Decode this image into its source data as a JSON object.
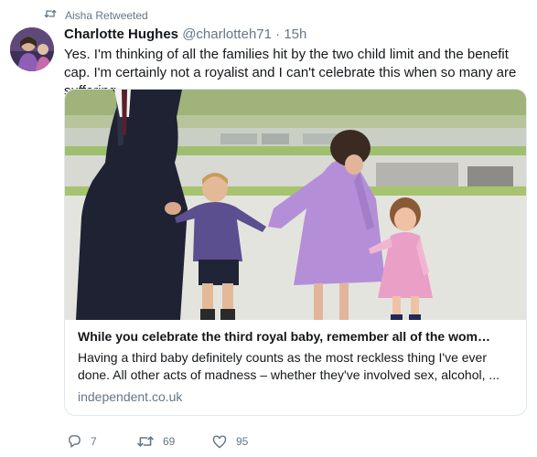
{
  "retweet_context": {
    "icon": "retweet-icon",
    "text": "Aisha Retweeted"
  },
  "tweet": {
    "name": "Charlotte Hughes",
    "handle": "@charlotteh71",
    "separator": "·",
    "time": "15h",
    "text": "Yes. I'm thinking of all the families hit by the two child limit and the benefit cap. I'm certainly not a royalist and I can't celebrate this when so many are suffering."
  },
  "card": {
    "title": "While you celebrate the third royal baby, remember all of the wom…",
    "description": "Having a third baby definitely counts as the most reckless thing I've ever done. All other acts of madness – whether they've involved sex, alcohol, ...",
    "domain": "independent.co.uk"
  },
  "actions": {
    "reply": {
      "icon": "reply-icon",
      "count": "7"
    },
    "retweet": {
      "icon": "retweet-icon",
      "count": "69"
    },
    "like": {
      "icon": "heart-icon",
      "count": "95"
    }
  },
  "colors": {
    "secondary_text": "#657786",
    "primary_text": "#14171a",
    "border": "#e1e8ed"
  }
}
